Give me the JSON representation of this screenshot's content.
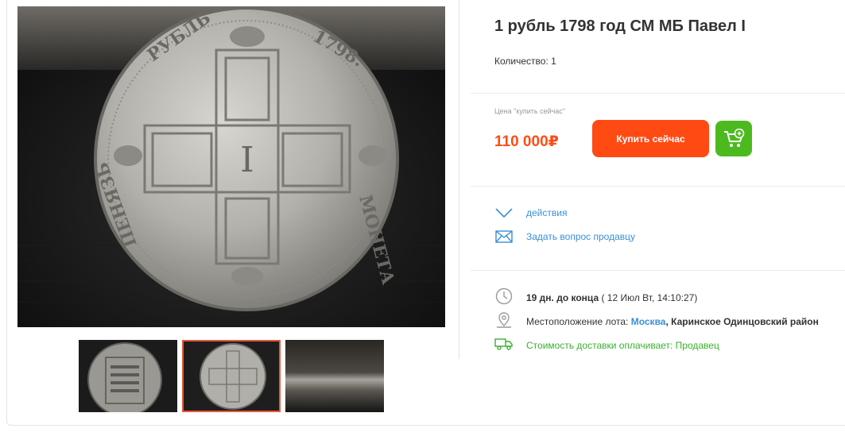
{
  "lot": {
    "title": "1 рубль 1798 год СМ МБ Павел I",
    "quantity": "Количество: 1"
  },
  "price": {
    "caption": "Цена \"купить сейчас\"",
    "value": "110 000₽",
    "buy_label": "Купить сейчас",
    "accent": "#ff4a14",
    "cart_color": "#4cba1e"
  },
  "actions": {
    "actions_label": "действия",
    "ask_label": "Задать вопрос продавцу"
  },
  "details": {
    "time_left": "19 дн. до конца",
    "end_date": " ( 12 Июл Вт, 14:10:27)",
    "location_label": "Местоположение лота: ",
    "city": "Москва",
    "region": ", Каринское Одинцовский район",
    "delivery": "Стоимость доставки оплачивает: Продавец"
  },
  "coin_legend": "МОНЕТА · РУБЛЬ · 1798 · ПЕНЯЗЬ",
  "icons": [
    "chevron-down-icon",
    "envelope-icon",
    "clock-icon",
    "map-pin-icon",
    "truck-icon",
    "cart-plus-icon"
  ]
}
